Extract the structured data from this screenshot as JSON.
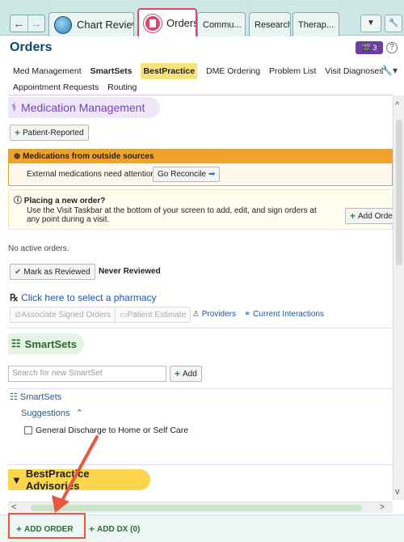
{
  "tabs": {
    "chart_review": "Chart Review",
    "orders": "Orders",
    "communications": "Commu...",
    "research": "Research",
    "therapy": "Therap..."
  },
  "header": {
    "title": "Orders",
    "help": "?",
    "badge": "3"
  },
  "nav": {
    "items": [
      "Med Management",
      "SmartSets",
      "BestPractice",
      "DME Ordering",
      "Problem List",
      "Visit Diagnoses",
      "Appointment Requests",
      "Routing"
    ]
  },
  "med_management": {
    "title": "Medication Management",
    "patient_reported": "Patient-Reported",
    "outside_title": "Medications from outside sources",
    "outside_text": "External medications need attention.",
    "go_reconcile": "Go Reconcile",
    "new_order_title": "Placing a new order?",
    "new_order_text": "Use the Visit Taskbar at the bottom of your screen to add, edit, and sign orders at any point during a visit.",
    "add_order": "Add Orde",
    "no_active": "No active orders.",
    "mark_reviewed": "Mark as Reviewed",
    "never_reviewed": "Never Reviewed",
    "pharmacy_link": "Click here to select a pharmacy",
    "associate": "Associate Signed Orders",
    "patient_estimate": "Patient Estimate",
    "providers": "Providers",
    "interactions": "Current Interactions"
  },
  "smartsets": {
    "title": "SmartSets",
    "search_placeholder": "Search for new SmartSet",
    "add": "Add",
    "sub": "SmartSets",
    "suggestions": "Suggestions",
    "item": "General Discharge to Home or Self Care"
  },
  "bpa": {
    "title": "BestPractice Advisories"
  },
  "taskbar": {
    "add_order": "ADD ORDER",
    "add_dx": "ADD DX (0)"
  },
  "colors": {
    "accent": "#d9466e",
    "annotation": "#e8573f"
  }
}
